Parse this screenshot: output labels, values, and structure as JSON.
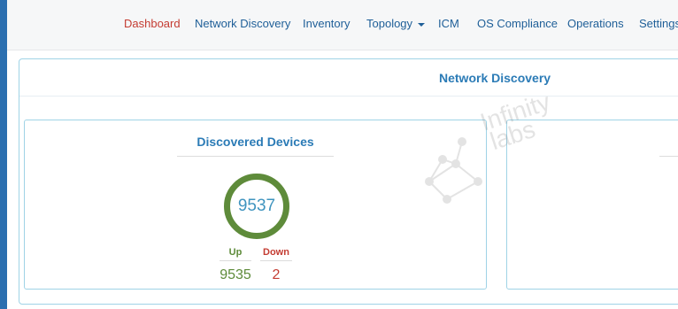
{
  "nav": {
    "items": [
      {
        "label": "Dashboard",
        "active": true
      },
      {
        "label": "Network Discovery",
        "active": false
      },
      {
        "label": "Inventory",
        "active": false
      },
      {
        "label": "Topology",
        "active": false,
        "has_dropdown": true
      },
      {
        "label": "ICM",
        "active": false
      },
      {
        "label": "OS Compliance",
        "active": false
      },
      {
        "label": "Operations",
        "active": false
      },
      {
        "label": "Settings",
        "active": false
      }
    ]
  },
  "main": {
    "title": "Network Discovery"
  },
  "discovered_devices": {
    "title": "Discovered Devices",
    "total": "9537",
    "up_label": "Up",
    "down_label": "Down",
    "up_value": "9535",
    "down_value": "2"
  },
  "watermark": {
    "text_line1": "Infinity",
    "text_line2": "labs"
  },
  "colors": {
    "accent_blue": "#2b7bb6",
    "nav_blue": "#1f5f98",
    "active_red": "#c43c32",
    "up_green": "#5e8b3a",
    "panel_border": "#9fd3e6"
  }
}
